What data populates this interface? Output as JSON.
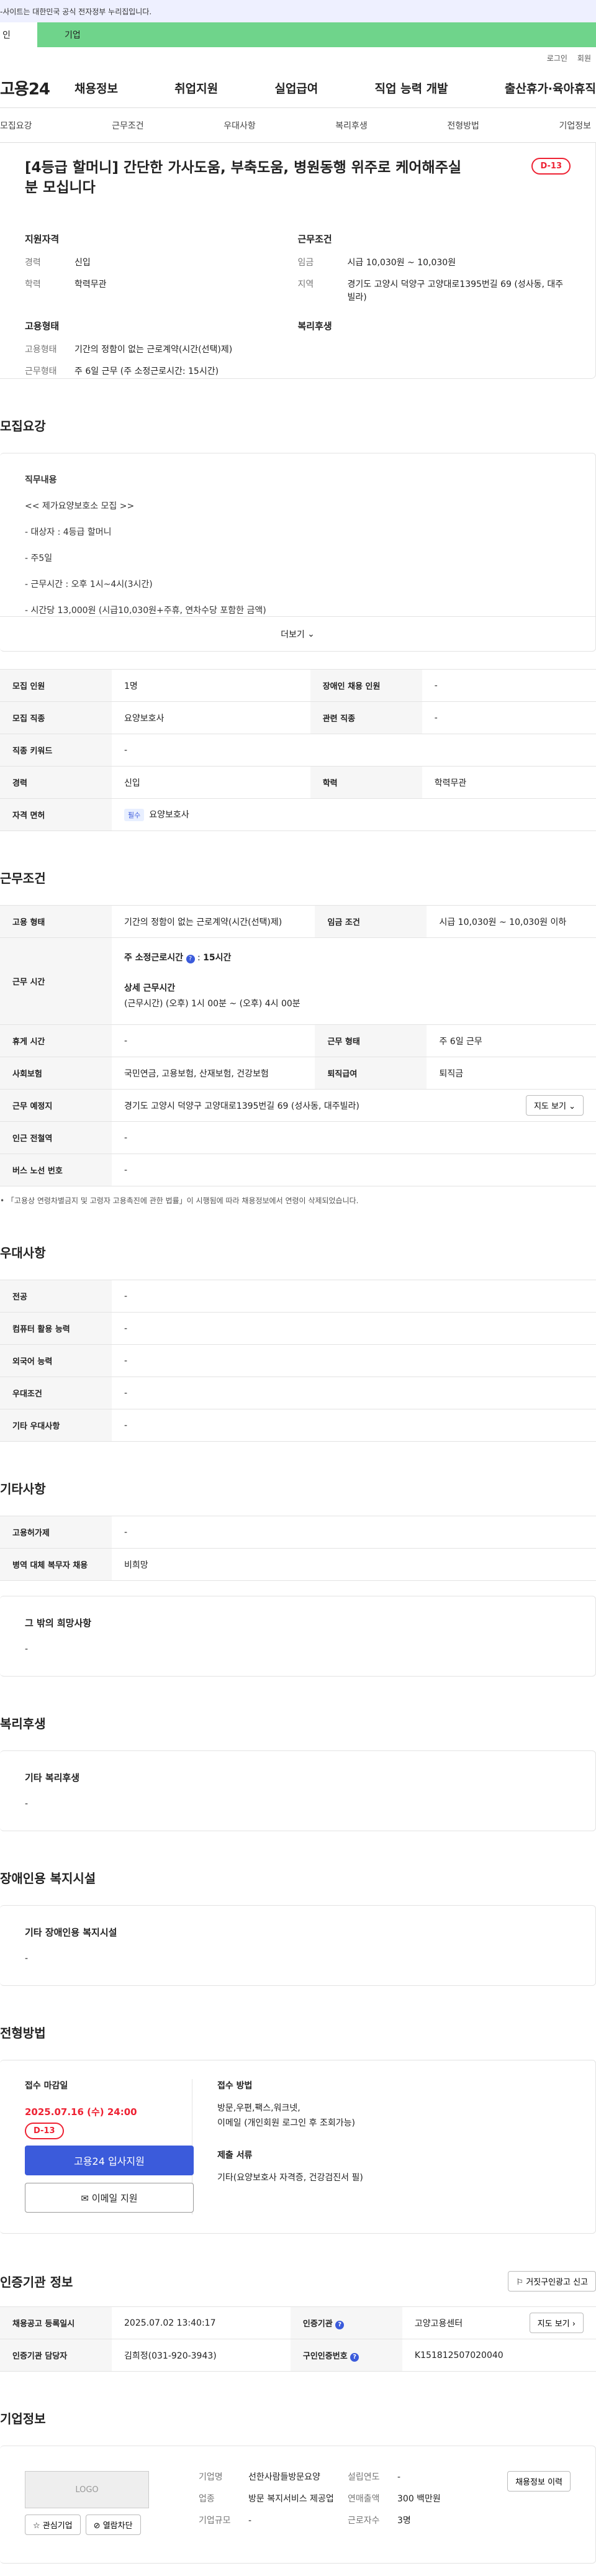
{
  "top_notice": "-사이트는 대한민국 공식 전자정부 누리집입니다.",
  "tabs": {
    "personal": "인",
    "company": "기업"
  },
  "util": {
    "login": "로그인",
    "join": "회원"
  },
  "gnb": {
    "logo": "고용24",
    "menu": [
      "채용정보",
      "취업지원",
      "실업급여",
      "직업 능력 개발",
      "출산휴가·육아휴직"
    ]
  },
  "subnav": [
    "모집요강",
    "근무조건",
    "우대사항",
    "복리후생",
    "전형방법",
    "기업정보"
  ],
  "summary": {
    "title": "[4등급 할머니] 간단한 가사도움, 부축도움, 병원동행 위주로 케어해주실분 모십니다",
    "dday": "D-13",
    "qual_title": "지원자격",
    "career_k": "경력",
    "career_v": "신입",
    "edu_k": "학력",
    "edu_v": "학력무관",
    "cond_title": "근무조건",
    "wage_k": "임금",
    "wage_v": "시급 10,030원 ~ 10,030원",
    "loc_k": "지역",
    "loc_v": "경기도 고양시 덕양구 고양대로1395번길 69 (성사동, 대주빌라)",
    "emp_title": "고용형태",
    "type_k": "고용형태",
    "type_v": "기간의 정함이 없는 근로계약(시간(선택)제)",
    "hours_k": "근무형태",
    "hours_v": "주 6일 근무 (주 소정근로시간: 15시간)",
    "welfare_title": "복리후생"
  },
  "req": {
    "title": "모집요강",
    "job_label": "직무내용",
    "lines": [
      "<< 제가요양보호소 모집 >>",
      "- 대상자 : 4등급 할머니",
      "- 주5일",
      "- 근무시간 :  오후 1시~4시(3시간)",
      "- 시간당 13,000원 (시급10,030원+주휴, 연차수당 포함한 금액)"
    ],
    "more": "더보기"
  },
  "req_table": {
    "r1": [
      "모집 인원",
      "1명",
      "장애인 채용 인원",
      "-"
    ],
    "r2": [
      "모집 직종",
      "요양보호사",
      "관련 직종",
      "-"
    ],
    "r3": [
      "직종 키워드",
      "-"
    ],
    "r4": [
      "경력",
      "신입",
      "학력",
      "학력무관"
    ],
    "r5_k": "자격 면허",
    "r5_chip": "필수",
    "r5_v": "요양보호사"
  },
  "cond": {
    "title": "근무조건",
    "r1": [
      "고용 형태",
      "기간의 정함이 없는 근로계약(시간(선택)제)",
      "임금 조건",
      "시급 10,030원 ~ 10,030원 이하"
    ],
    "time_k": "근무 시간",
    "time_week": "주 소정근로시간",
    "time_week_v": "15시간",
    "time_detail": "상세 근무시간",
    "time_detail_v": "(근무시간) (오후) 1시 00분 ~ (오후) 4시 00분",
    "r3": [
      "휴게 시간",
      "-",
      "근무 형태",
      "주 6일 근무"
    ],
    "r4": [
      "사회보험",
      "국민연금, 고용보험, 산재보험, 건강보험",
      "퇴직급여",
      "퇴직금"
    ],
    "r5_k": "근무 예정지",
    "r5_v": "경기도 고양시 덕양구 고양대로1395번길 69 (성사동, 대주빌라)",
    "map_btn": "지도 보기",
    "r6": [
      "인근 전철역",
      "-"
    ],
    "r7": [
      "버스 노선 번호",
      "-"
    ],
    "note": "「고용상 연령차별금지 및 고령자 고용촉진에 관한 법률」이 시행됨에 따라 채용정보에서 연령이 삭제되었습니다."
  },
  "pref": {
    "title": "우대사항",
    "rows": [
      [
        "전공",
        "-"
      ],
      [
        "컴퓨터 활용 능력",
        "-"
      ],
      [
        "외국어 능력",
        "-"
      ],
      [
        "우대조건",
        "-"
      ],
      [
        "기타 우대사항",
        "-"
      ]
    ]
  },
  "etc": {
    "title": "기타사항",
    "rows": [
      [
        "고용허가제",
        "-"
      ],
      [
        "병역 대체 복무자 채용",
        "비희망"
      ]
    ],
    "box_title": "그 밖의 희망사항",
    "box_v": "-"
  },
  "welfare": {
    "title": "복리후생",
    "box_title": "기타 복리후생",
    "box_v": "-"
  },
  "disabled": {
    "title": "장애인용 복지시설",
    "box_title": "기타 장애인용 복지시설",
    "box_v": "-"
  },
  "apply": {
    "title": "전형방법",
    "deadline_label": "접수 마감일",
    "deadline": "2025.07.16 (수) 24:00",
    "dday": "D-13",
    "btn_primary": "고용24 입사지원",
    "btn_email": "이메일 지원",
    "method_label": "접수 방법",
    "method_v1": "방문,우편,팩스,워크넷,",
    "method_v2": "이메일 (개인회원 로그인 후 조회가능)",
    "docs_label": "제출 서류",
    "docs_v": "기타(요양보호사 자격증, 건강검진서 필)"
  },
  "cert": {
    "title": "인증기관 정보",
    "report_btn": "거짓구인광고 신고",
    "r1": [
      "채용공고 등록일시",
      "2025.07.02 13:40:17",
      "인증기관",
      "고양고용센터"
    ],
    "map_btn": "지도 보기",
    "r2": [
      "인증기관 담당자",
      "김희정(031-920-3943)",
      "구인인증번호",
      "K151812507020040"
    ]
  },
  "company": {
    "title": "기업정보",
    "logo": "LOGO",
    "fav_btn": "관심기업",
    "block_btn": "열람차단",
    "name_k": "기업명",
    "name_v": "선한사람들방문요양",
    "ind_k": "업종",
    "ind_v": "방문 복지서비스 제공업",
    "scale_k": "기업규모",
    "scale_v": "-",
    "year_k": "설립연도",
    "year_v": "-",
    "sales_k": "연매출액",
    "sales_v": "300 백만원",
    "emp_k": "근로자수",
    "emp_v": "3명",
    "history_btn": "채용정보 이력"
  }
}
